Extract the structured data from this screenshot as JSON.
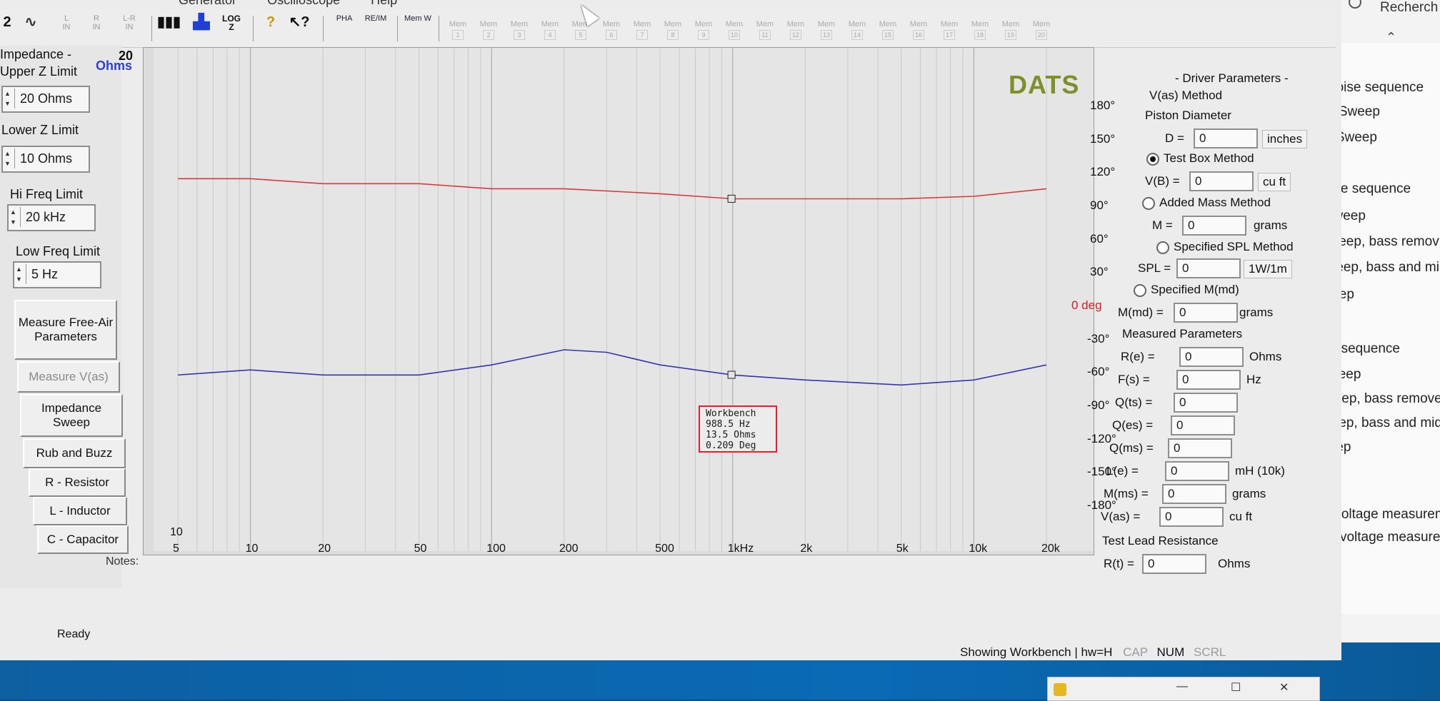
{
  "menubar": [
    "Generator",
    "Oscilloscope",
    "Help"
  ],
  "toolbar": {
    "channels": [
      {
        "top": "L",
        "bot": "IN"
      },
      {
        "top": "R",
        "bot": "IN"
      },
      {
        "top": "L-R",
        "bot": "IN"
      }
    ],
    "buttons": [
      "PHA",
      "RE/IM",
      "Mem W"
    ],
    "log": "LOG Z",
    "mem_slots": [
      "Mem",
      "Mem",
      "Mem",
      "Mem",
      "Mem",
      "Mem",
      "Mem",
      "Mem",
      "Mem",
      "Mem",
      "Mem",
      "Mem",
      "Mem",
      "Mem",
      "Mem",
      "Mem",
      "Mem",
      "Mem",
      "Mem",
      "Mem"
    ],
    "mem_nums": [
      "1",
      "2",
      "3",
      "4",
      "5",
      "6",
      "7",
      "8",
      "9",
      "10",
      "11",
      "12",
      "13",
      "14",
      "15",
      "16",
      "17",
      "18",
      "19",
      "20"
    ]
  },
  "left": {
    "impedance_title": "Impedance -",
    "upper_label": "Upper Z Limit",
    "upper_value": "20 Ohms",
    "lower_label": "Lower Z Limit",
    "lower_value": "10 Ohms",
    "hifreq_label": "Hi Freq Limit",
    "hifreq_value": "20 kHz",
    "lowfreq_label": "Low Freq Limit",
    "lowfreq_value": "5 Hz",
    "btn_measure": "Measure Free-Air Parameters",
    "btn_vas": "Measure V(as)",
    "btn_sweep": "Impedance Sweep",
    "btn_rub": "Rub and Buzz",
    "btn_r": "R - Resistor",
    "btn_l": "L - Inductor",
    "btn_c": "C - Capacitor",
    "notes": "Notes:"
  },
  "chart_data": {
    "type": "line",
    "brand": "DATS",
    "z_top": "20",
    "z_unit": "Ohms",
    "z_bottom": "10",
    "x_ticks": [
      "5",
      "10",
      "20",
      "50",
      "100",
      "200",
      "500",
      "1kHz",
      "2k",
      "5k",
      "10k",
      "20k"
    ],
    "x_tick_values": [
      5,
      10,
      20,
      50,
      100,
      200,
      500,
      1000,
      2000,
      5000,
      10000,
      20000
    ],
    "xlim": [
      5,
      20000
    ],
    "ylim_impedance": [
      10,
      20
    ],
    "ylim_phase": [
      -180,
      180
    ],
    "phase_ticks": [
      "180°",
      "150°",
      "120°",
      "90°",
      "60°",
      "30°",
      "0 deg",
      "-30°",
      "-60°",
      "-90°",
      "-120°",
      "-150°",
      "-180°"
    ],
    "phase_tick_values": [
      180,
      150,
      120,
      90,
      60,
      30,
      0,
      -30,
      -60,
      -90,
      -120,
      -150,
      -180
    ],
    "series": [
      {
        "color": "#d83a3a",
        "x": [
          5,
          10,
          20,
          50,
          100,
          200,
          500,
          1000,
          2000,
          5000,
          10000,
          20000
        ],
        "values": [
          17.4,
          17.4,
          17.3,
          17.3,
          17.2,
          17.2,
          17.1,
          17.0,
          17.0,
          17.0,
          17.05,
          17.2
        ]
      },
      {
        "color": "#3535b0",
        "x": [
          5,
          10,
          20,
          50,
          100,
          200,
          300,
          500,
          1000,
          2000,
          5000,
          10000,
          20000
        ],
        "values": [
          13.5,
          13.6,
          13.5,
          13.5,
          13.7,
          14.0,
          13.95,
          13.7,
          13.5,
          13.4,
          13.3,
          13.4,
          13.7
        ]
      }
    ],
    "cursor_x": 988.5
  },
  "tooltip": {
    "title": "Workbench",
    "freq": "988.5 Hz",
    "ohms": "13.5 Ohms",
    "deg": "0.209 Deg"
  },
  "right": {
    "title": "- Driver Parameters -",
    "vas_method": "V(as) Method",
    "piston": "Piston Diameter",
    "d_label": "D =",
    "d_value": "0",
    "d_unit": "inches",
    "testbox": "Test Box Method",
    "vb_label": "V(B) =",
    "vb_value": "0",
    "vb_unit": "cu ft",
    "addedmass": "Added Mass Method",
    "m_label": "M =",
    "m_value": "0",
    "m_unit": "grams",
    "spl_method": "Specified SPL Method",
    "spl_label": "SPL =",
    "spl_value": "0",
    "spl_unit": "1W/1m",
    "mmd_method": "Specified M(md)",
    "mmd_label": "M(md) =",
    "mmd_value": "0",
    "mmd_unit": "grams",
    "measured": "Measured Parameters",
    "params": [
      {
        "label": "R(e) =",
        "value": "0",
        "unit": "Ohms"
      },
      {
        "label": "F(s) =",
        "value": "0",
        "unit": "Hz"
      },
      {
        "label": "Q(ts) =",
        "value": "0",
        "unit": ""
      },
      {
        "label": "Q(es) =",
        "value": "0",
        "unit": ""
      },
      {
        "label": "Q(ms) =",
        "value": "0",
        "unit": ""
      },
      {
        "label": "L(e) =",
        "value": "0",
        "unit": "mH (10k)"
      },
      {
        "label": "M(ms) =",
        "value": "0",
        "unit": "grams"
      },
      {
        "label": "V(as) =",
        "value": "0",
        "unit": "cu ft"
      }
    ],
    "testlead": "Test Lead Resistance",
    "rt_label": "R(t) =",
    "rt_value": "0",
    "rt_unit": "Ohms"
  },
  "status": {
    "ready": "Ready",
    "showing": "Showing Workbench | hw=H",
    "cap": "CAP",
    "num": "NUM",
    "scrl": "SCRL"
  },
  "background": {
    "search": "Recherch",
    "items": [
      "noise sequence",
      "e Sweep",
      "e Sweep",
      "ep",
      "noise sequence",
      "e Sweep",
      "e Sweep, bass remov",
      "e Sweep, bass and mi",
      "e Sweep",
      "eep",
      "o-noise sequence",
      "Sine Sweep",
      "Sine Sweep, bass remove",
      "Sine Sweep, bass and mid",
      "Sine Sweep",
      "weep",
      "z Tone for voltage measurem",
      "rtz Tone for voltage measuren"
    ]
  }
}
